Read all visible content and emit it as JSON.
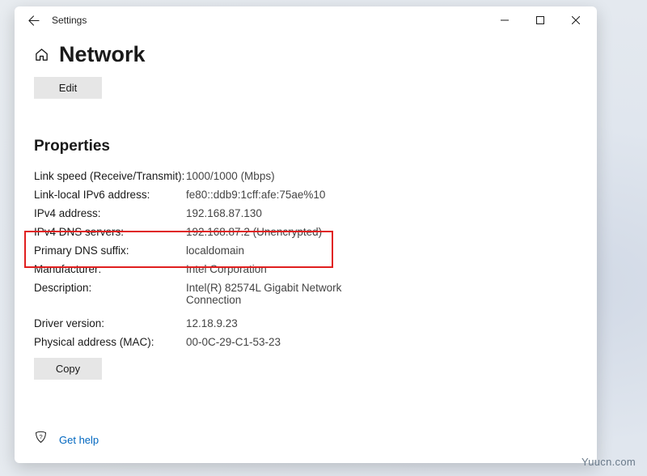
{
  "window": {
    "title": "Settings"
  },
  "page": {
    "title": "Network",
    "edit_label": "Edit",
    "section_heading": "Properties",
    "copy_label": "Copy"
  },
  "properties": [
    {
      "label": "Link speed (Receive/Transmit):",
      "value": "1000/1000 (Mbps)"
    },
    {
      "label": "Link-local IPv6 address:",
      "value": "fe80::ddb9:1cff:afe:75ae%10"
    },
    {
      "label": "IPv4 address:",
      "value": "192.168.87.130"
    },
    {
      "label": "IPv4 DNS servers:",
      "value": "192.168.87.2 (Unencrypted)"
    },
    {
      "label": "Primary DNS suffix:",
      "value": "localdomain"
    },
    {
      "label": "Manufacturer:",
      "value": "Intel Corporation"
    },
    {
      "label": "Description:",
      "value": "Intel(R) 82574L Gigabit Network Connection"
    },
    {
      "label": "Driver version:",
      "value": "12.18.9.23"
    },
    {
      "label": "Physical address (MAC):",
      "value": "00-0C-29-C1-53-23"
    }
  ],
  "footer": {
    "help_label": "Get help"
  },
  "watermark": "Yuucn.com"
}
